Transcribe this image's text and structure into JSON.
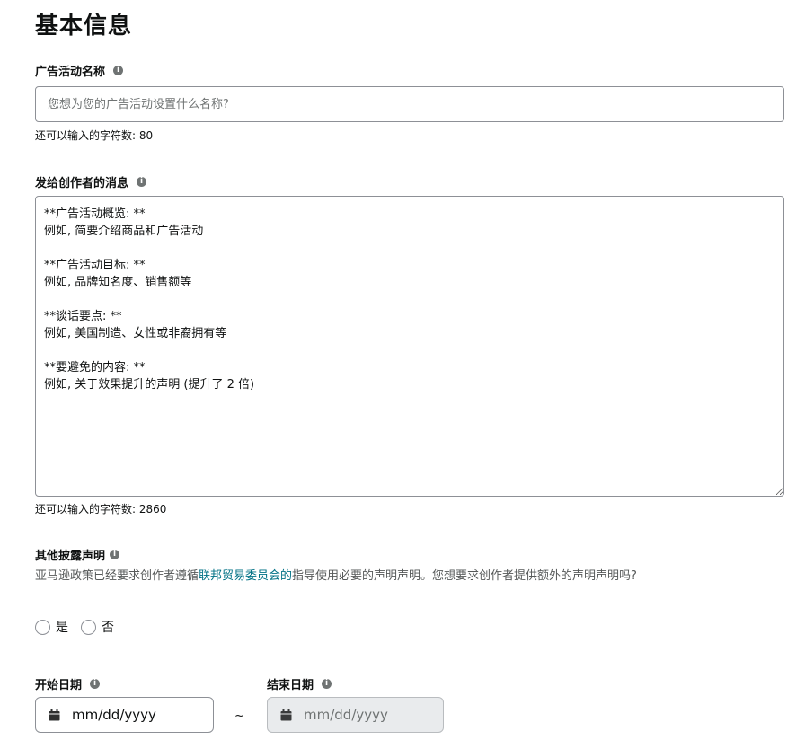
{
  "section_title": "基本信息",
  "campaign_name": {
    "label": "广告活动名称",
    "placeholder": "您想为您的广告活动设置什么名称?",
    "char_count": "还可以输入的字符数: 80"
  },
  "creator_message": {
    "label": "发给创作者的消息",
    "value": "**广告活动概览: **\n例如, 简要介绍商品和广告活动\n\n**广告活动目标: **\n例如, 品牌知名度、销售额等\n\n**谈话要点: **\n例如, 美国制造、女性或非裔拥有等\n\n**要避免的内容: **\n例如, 关于效果提升的声明 (提升了 2 倍)",
    "char_count": "还可以输入的字符数: 2860"
  },
  "disclosure": {
    "label": "其他披露声明",
    "desc_before": "亚马逊政策已经要求创作者遵循",
    "desc_link": "联邦贸易委员会的",
    "desc_after": "指导使用必要的声明声明。您想要求创作者提供额外的声明声明吗?",
    "option_yes": "是",
    "option_no": "否"
  },
  "dates": {
    "start_label": "开始日期",
    "end_label": "结束日期",
    "start_placeholder": "mm/dd/yyyy",
    "end_placeholder": "mm/dd/yyyy",
    "separator": "~"
  },
  "info_glyph": "i",
  "icons": {
    "info": "info-icon",
    "calendar": "calendar-icon"
  },
  "colors": {
    "link": "#007185",
    "border": "#8d9096",
    "disabled_bg": "#e9ebed"
  }
}
